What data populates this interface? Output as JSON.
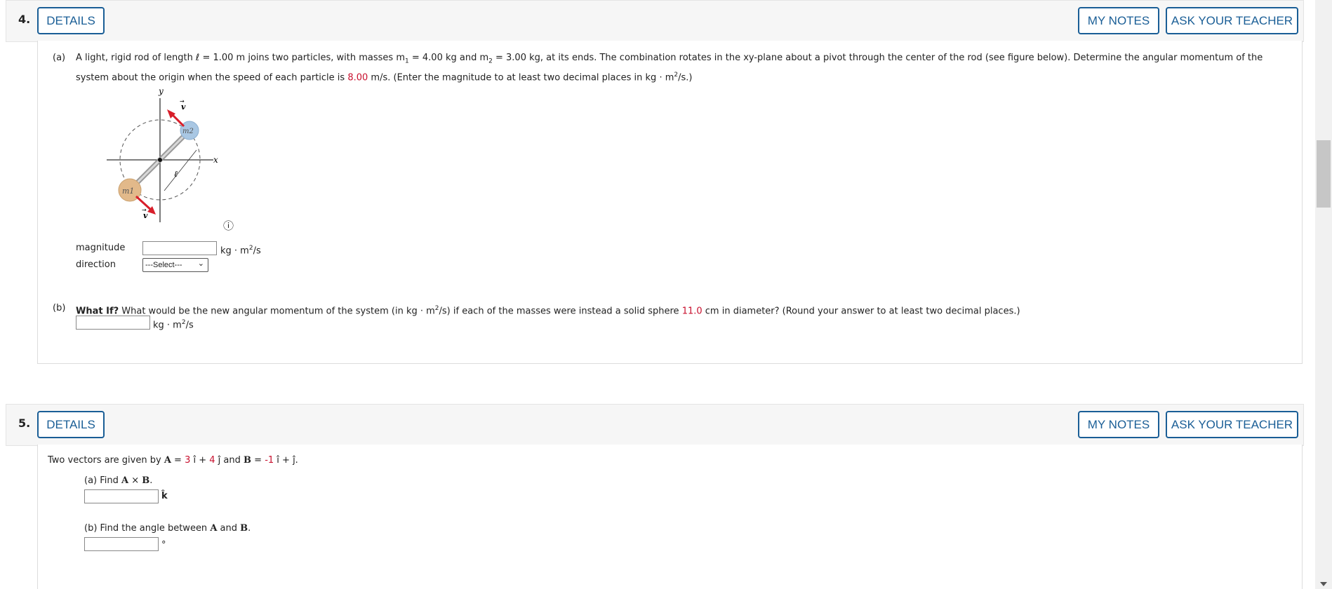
{
  "q4": {
    "number": "4.",
    "details_label": "DETAILS",
    "my_notes_label": "MY NOTES",
    "ask_teacher_label": "ASK YOUR TEACHER",
    "part_a": {
      "label": "(a)",
      "text_1": "A light, rigid rod of length ℓ = 1.00 m joins two particles, with masses m",
      "sub1": "1",
      "text_2": " = 4.00 kg and m",
      "sub2": "2",
      "text_3": " = 3.00 kg, at its ends. The combination rotates in the xy-plane about a pivot through the center of the rod (see figure below). Determine the angular momentum of the",
      "text_4": "system about the origin when the speed of each particle is ",
      "speed": "8.00",
      "text_5": " m/s. (Enter the magnitude to at least two decimal places in kg · m",
      "sup": "2",
      "text_6": "/s.)",
      "figure": {
        "y_label": "y",
        "x_label": "x",
        "v_label": "v",
        "m1_label": "m1",
        "m2_label": "m2",
        "l_label": "ℓ",
        "info_icon": "ⓘ"
      },
      "magnitude_label": "magnitude",
      "magnitude_unit": "kg · m",
      "magnitude_unit_sup": "2",
      "magnitude_unit_tail": "/s",
      "magnitude_value": "",
      "direction_label": "direction",
      "direction_selected": "---Select---"
    },
    "part_b": {
      "label": "(b)",
      "bold": "What If?",
      "text_1": " What would be the new angular momentum of the system (in kg · m",
      "sup": "2",
      "text_2": "/s) if each of the masses were instead a solid sphere ",
      "diameter": "11.0",
      "text_3": " cm in diameter? (Round your answer to at least two decimal places.)",
      "unit": "kg · m",
      "unit_sup": "2",
      "unit_tail": "/s",
      "value": ""
    }
  },
  "q5": {
    "number": "5.",
    "details_label": "DETAILS",
    "my_notes_label": "MY NOTES",
    "ask_teacher_label": "ASK YOUR TEACHER",
    "intro_1": "Two vectors are given by ",
    "A": "A",
    "eq1": " = ",
    "a_i": "3",
    "i_hat": " î + ",
    "a_j": "4",
    "j_hat": " ĵ",
    "and": " and ",
    "B": "B",
    "eq2": " = ",
    "b_i": "-1",
    "tail": " î + ĵ.",
    "part_a": {
      "text": "(a) Find ",
      "A": "A",
      "times": " × ",
      "B": "B",
      "end": ".",
      "unit": "k̂",
      "value": ""
    },
    "part_b": {
      "text": "(b) Find the angle between ",
      "A": "A",
      "and": " and ",
      "B": "B",
      "end": ".",
      "unit": "°",
      "value": ""
    }
  },
  "colors": {
    "accent": "#1a5e96",
    "given_value": "#c8102e",
    "v_arrow": "#d81e2a",
    "m1": "#e2b98a",
    "m2": "#a9c7e3"
  }
}
